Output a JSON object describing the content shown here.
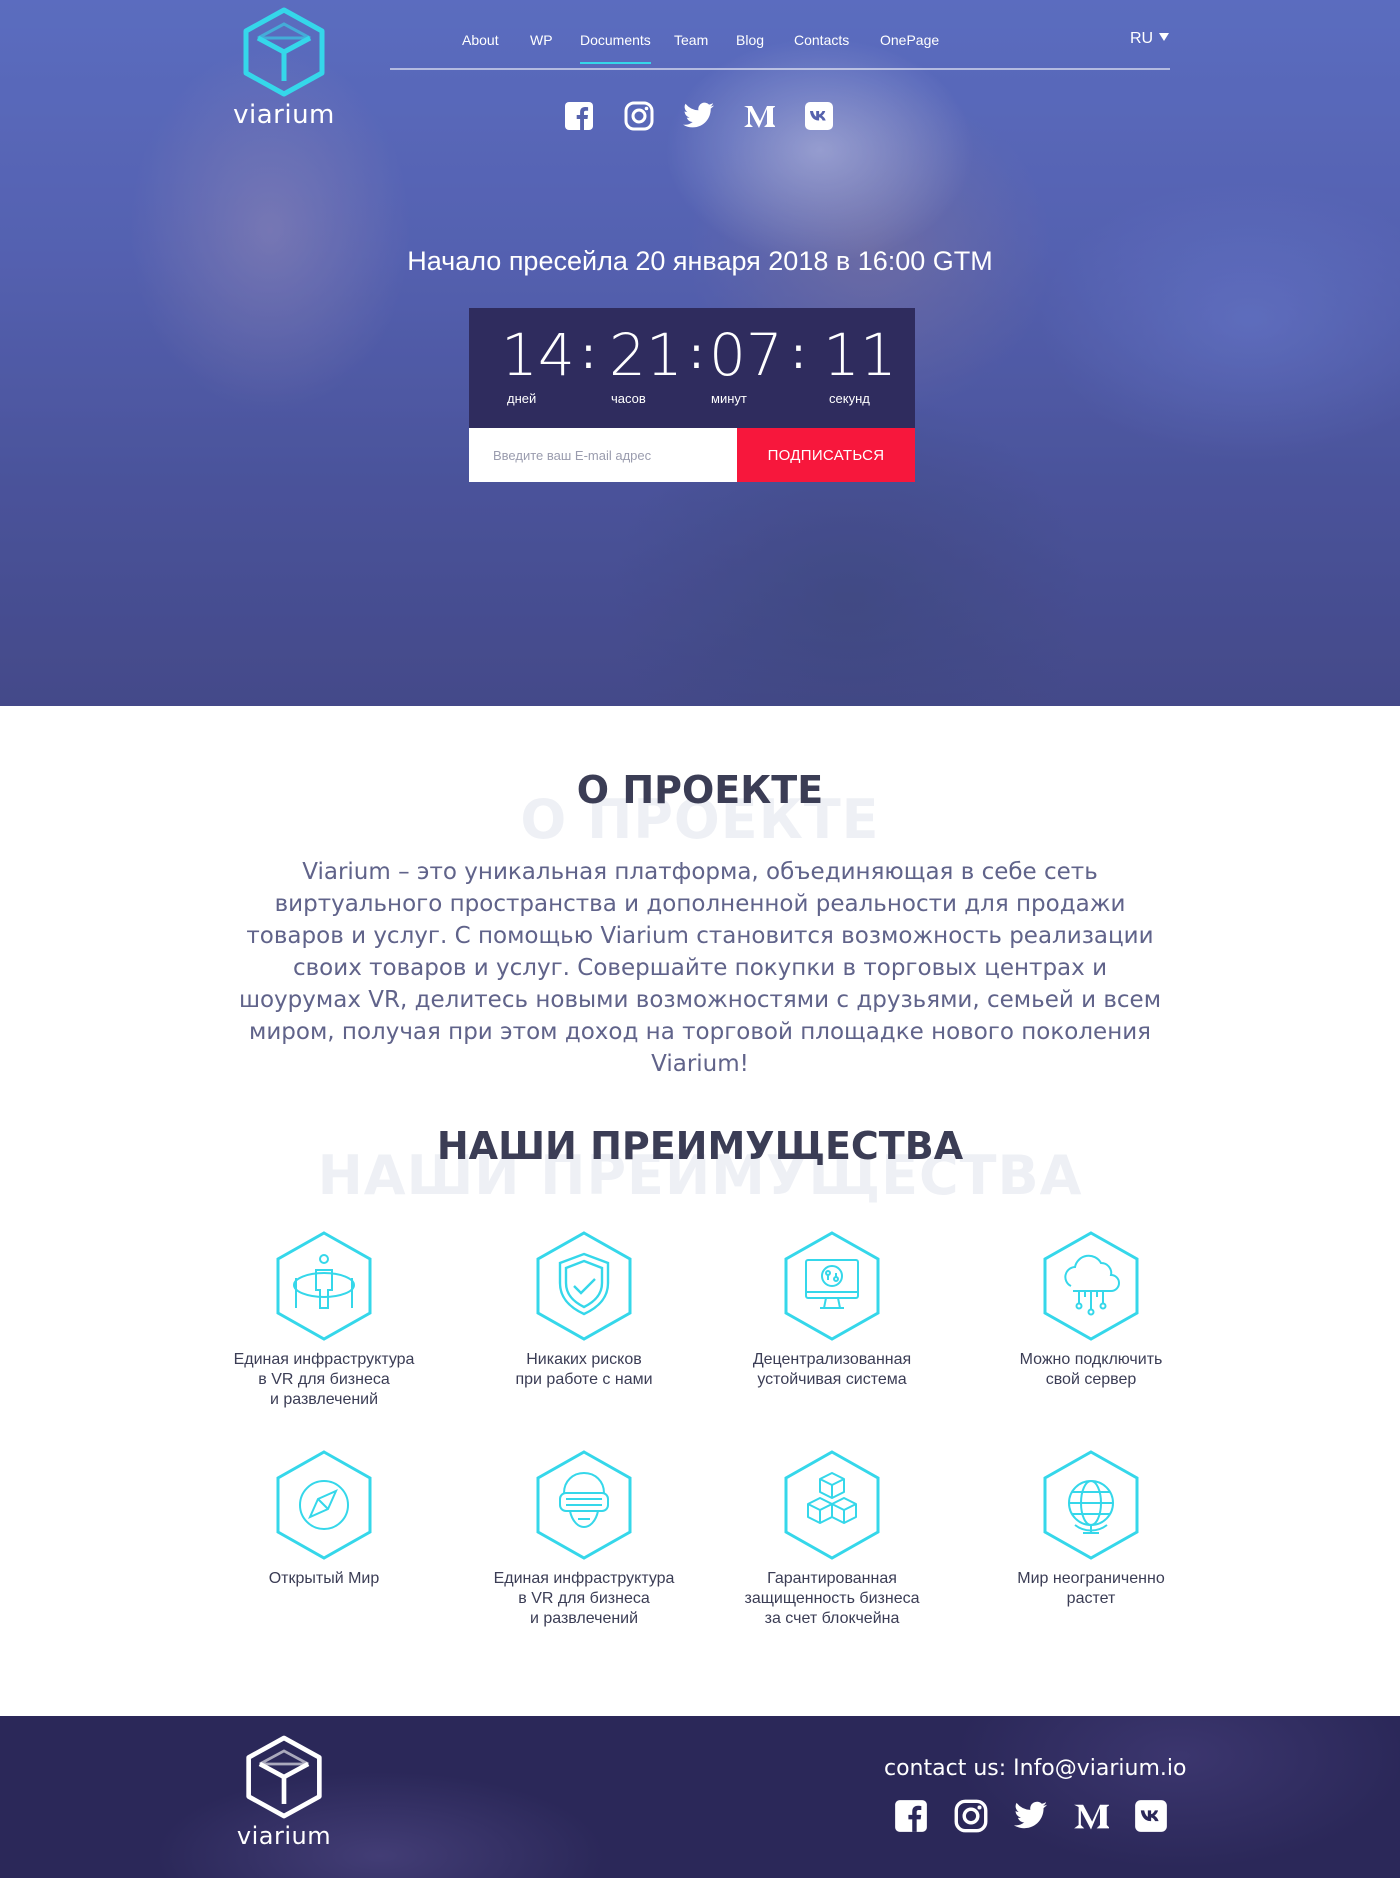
{
  "brand": {
    "name": "viarium",
    "accent": "#35d7ea",
    "primary_dark": "#2f2c5e",
    "cta": "#f7173c"
  },
  "nav": {
    "items": [
      {
        "label": "About"
      },
      {
        "label": "WP"
      },
      {
        "label": "Documents",
        "active": true
      },
      {
        "label": "Team"
      },
      {
        "label": "Blog"
      },
      {
        "label": "Contacts"
      },
      {
        "label": "OnePage"
      }
    ],
    "language": "RU"
  },
  "social": [
    "facebook-icon",
    "instagram-icon",
    "twitter-icon",
    "medium-icon",
    "vk-icon"
  ],
  "hero": {
    "presale": "Начало пресейла 20 января 2018 в 16:00 GTM",
    "countdown": {
      "days": "14",
      "hours": "21",
      "minutes": "07",
      "seconds": "11",
      "days_label": "дней",
      "hours_label": "часов",
      "minutes_label": "минут",
      "seconds_label": "секунд"
    },
    "email_placeholder": "Введите ваш E-mail адрес",
    "subscribe_label": "ПОДПИСАТЬСЯ"
  },
  "about": {
    "title": "О ПРОЕКТЕ",
    "paragraph": "Viarium – это уникальная платформа, объединяющая в себе сеть виртуального пространства и дополненной реальности для продажи товаров и услуг. С помощью Viarium становится возможность реализации своих товаров и услуг. Совершайте покупки в торговых центрах и шоурумах VR, делитесь новыми возможностями с друзьями, семьей и всем миром, получая при этом доход на торговой площадке нового поколения Viarium!"
  },
  "advantages": {
    "title": "НАШИ ПРЕИМУЩЕСТВА",
    "items": [
      {
        "icon": "vr-person-icon",
        "label": "Единая инфраструктура\nв VR для бизнеса\nи развлечений"
      },
      {
        "icon": "shield-check-icon",
        "label": "Никаких рисков\nпри работе с нами"
      },
      {
        "icon": "monitor-network-icon",
        "label": "Децентрализованная\nустойчивая система"
      },
      {
        "icon": "cloud-server-icon",
        "label": "Можно подключить\nсвой сервер"
      },
      {
        "icon": "compass-icon",
        "label": "Открытый Мир"
      },
      {
        "icon": "vr-headset-icon",
        "label": "Единая инфраструктура\nв VR для бизнеса\nи развлечений"
      },
      {
        "icon": "blocks-icon",
        "label": "Гарантированная\nзащищенность бизнеса\nза счет блокчейна"
      },
      {
        "icon": "globe-icon",
        "label": "Мир неограниченно\nрастет"
      }
    ]
  },
  "footer": {
    "contact": "contact us: Info@viarium.io"
  }
}
